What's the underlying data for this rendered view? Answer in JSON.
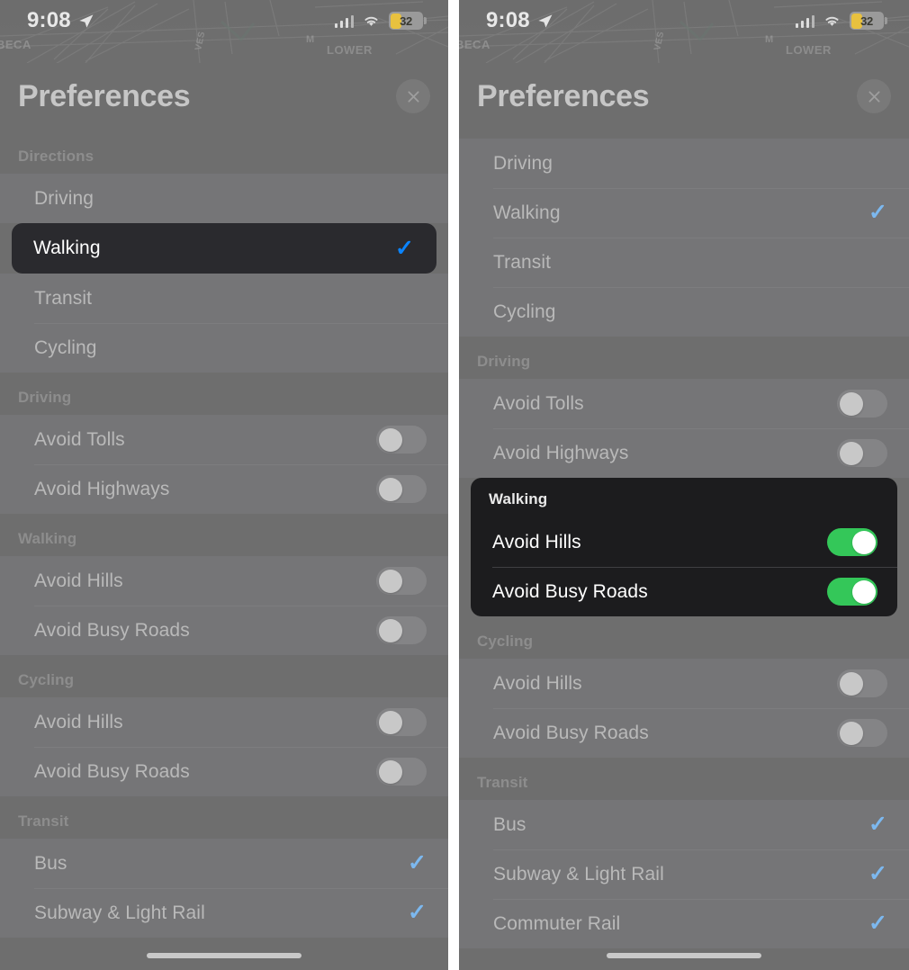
{
  "status_bar": {
    "time": "9:08",
    "location_arrow_icon": "location-arrow-icon",
    "cellular_icon": "cellular-bars-icon",
    "wifi_icon": "wifi-icon",
    "battery_percent": "32",
    "battery_color": "#e8c13f"
  },
  "map": {
    "labels": [
      "BECA",
      "VES",
      "M",
      "LOWER"
    ],
    "backdrop_color": "#6e6e6e"
  },
  "sheet": {
    "title": "Preferences",
    "close_icon": "close-icon"
  },
  "colors": {
    "accent_blue": "#0a84ff",
    "muted_blue": "#7cb8ef",
    "toggle_on_green": "#34c759",
    "highlight_dark": "#2a2a2e",
    "card_dark": "#1c1c1e",
    "panel_gray": "#6e6e6e"
  },
  "left_panel": {
    "sections": [
      {
        "header": "Directions",
        "rows": [
          {
            "label": "Driving",
            "type": "check",
            "checked": false,
            "highlighted": false
          },
          {
            "label": "Walking",
            "type": "check",
            "checked": true,
            "highlighted": true
          },
          {
            "label": "Transit",
            "type": "check",
            "checked": false,
            "highlighted": false
          },
          {
            "label": "Cycling",
            "type": "check",
            "checked": false,
            "highlighted": false
          }
        ]
      },
      {
        "header": "Driving",
        "rows": [
          {
            "label": "Avoid Tolls",
            "type": "toggle",
            "on": false
          },
          {
            "label": "Avoid Highways",
            "type": "toggle",
            "on": false
          }
        ]
      },
      {
        "header": "Walking",
        "rows": [
          {
            "label": "Avoid Hills",
            "type": "toggle",
            "on": false
          },
          {
            "label": "Avoid Busy Roads",
            "type": "toggle",
            "on": false
          }
        ]
      },
      {
        "header": "Cycling",
        "rows": [
          {
            "label": "Avoid Hills",
            "type": "toggle",
            "on": false
          },
          {
            "label": "Avoid Busy Roads",
            "type": "toggle",
            "on": false
          }
        ]
      },
      {
        "header": "Transit",
        "rows": [
          {
            "label": "Bus",
            "type": "check",
            "checked": true
          },
          {
            "label": "Subway & Light Rail",
            "type": "check",
            "checked": true
          }
        ]
      }
    ]
  },
  "right_panel": {
    "sections": [
      {
        "header": "",
        "rows": [
          {
            "label": "Driving",
            "type": "check",
            "checked": false
          },
          {
            "label": "Walking",
            "type": "check",
            "checked": true
          },
          {
            "label": "Transit",
            "type": "check",
            "checked": false
          },
          {
            "label": "Cycling",
            "type": "check",
            "checked": false
          }
        ]
      },
      {
        "header": "Driving",
        "rows": [
          {
            "label": "Avoid Tolls",
            "type": "toggle",
            "on": false
          },
          {
            "label": "Avoid Highways",
            "type": "toggle",
            "on": false
          }
        ]
      },
      {
        "header": "Walking",
        "highlighted": true,
        "rows": [
          {
            "label": "Avoid Hills",
            "type": "toggle",
            "on": true
          },
          {
            "label": "Avoid Busy Roads",
            "type": "toggle",
            "on": true
          }
        ]
      },
      {
        "header": "Cycling",
        "rows": [
          {
            "label": "Avoid Hills",
            "type": "toggle",
            "on": false
          },
          {
            "label": "Avoid Busy Roads",
            "type": "toggle",
            "on": false
          }
        ]
      },
      {
        "header": "Transit",
        "rows": [
          {
            "label": "Bus",
            "type": "check",
            "checked": true
          },
          {
            "label": "Subway & Light Rail",
            "type": "check",
            "checked": true
          },
          {
            "label": "Commuter Rail",
            "type": "check",
            "checked": true
          }
        ]
      }
    ]
  }
}
